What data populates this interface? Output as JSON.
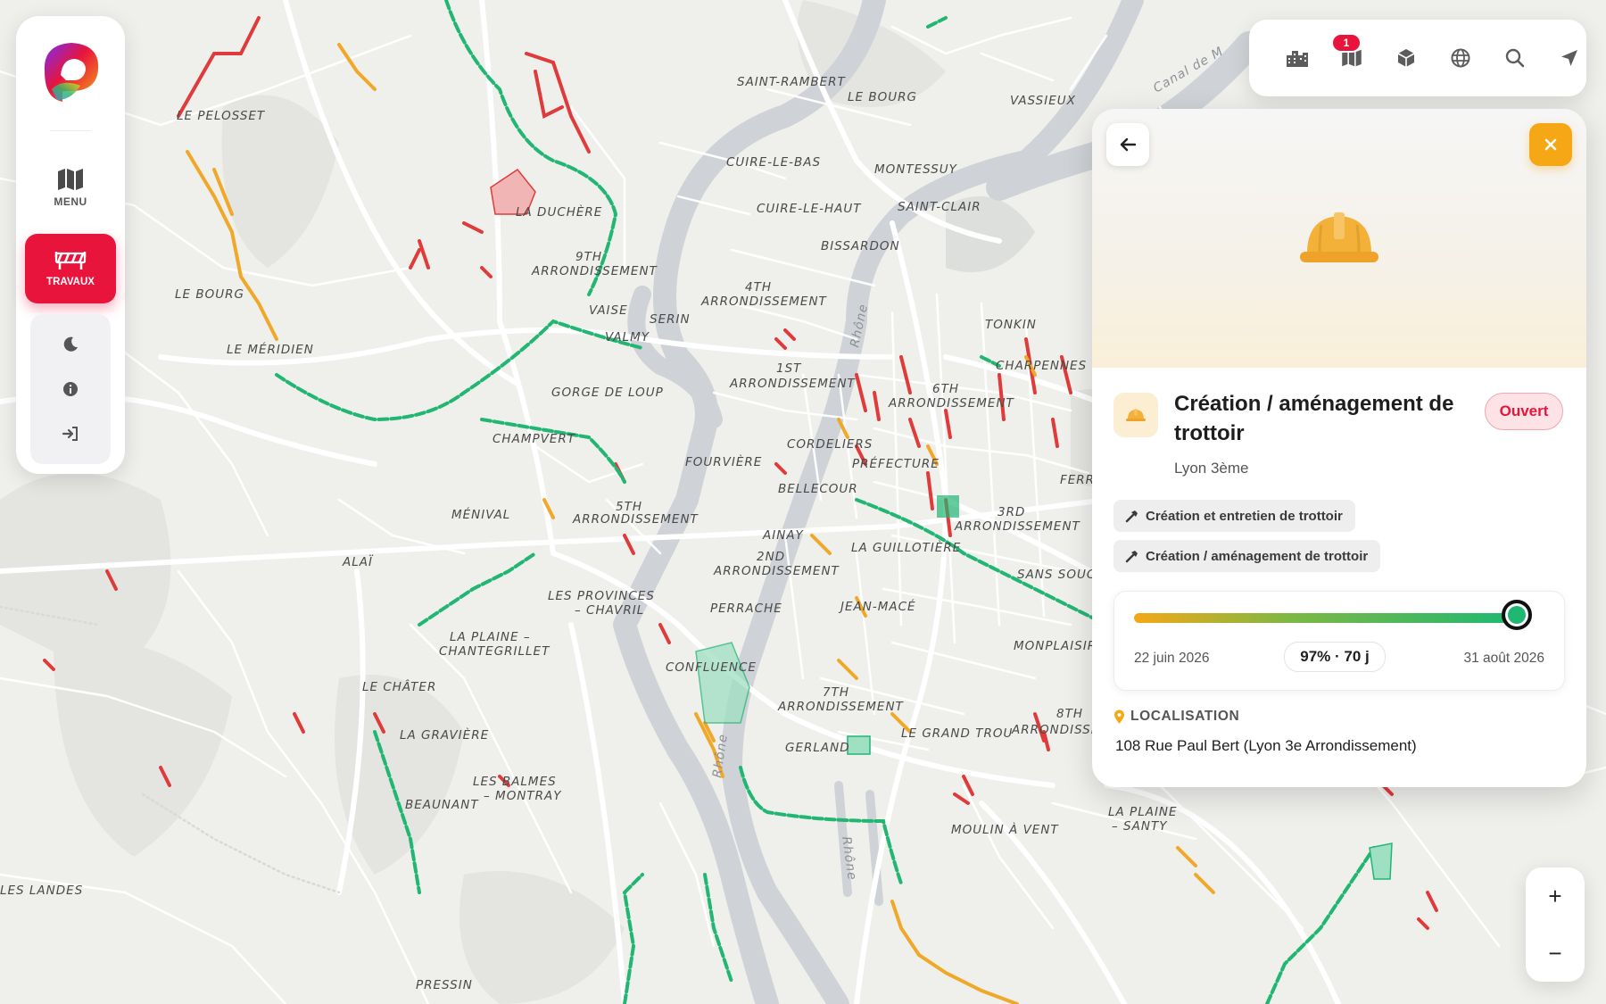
{
  "sidebar": {
    "menu_label": "MENU",
    "travaux_label": "TRAVAUX",
    "icons": [
      "map-icon",
      "roadworks-barrier-icon",
      "moon-icon",
      "info-icon",
      "login-icon"
    ]
  },
  "toolbar": {
    "buttons": [
      "buildings-icon",
      "map-layers-icon",
      "cube-3d-icon",
      "globe-icon",
      "search-icon",
      "locate-arrow-icon"
    ],
    "notification_count": "1"
  },
  "map": {
    "labels": [
      {
        "text": "SAINT-RAMBERT"
      },
      {
        "text": "LE BOURG"
      },
      {
        "text": "VASSIEUX"
      },
      {
        "text": "LE PELOSSET"
      },
      {
        "text": "CUIRE-LE-BAS"
      },
      {
        "text": "MONTESSUY"
      },
      {
        "text": "CUIRE-LE-HAUT"
      },
      {
        "text": "SAINT-CLAIR"
      },
      {
        "text": "LA DUCHÈRE"
      },
      {
        "text": "BISSARDON"
      },
      {
        "text": "9TH"
      },
      {
        "text": "ARRONDISSEMENT"
      },
      {
        "text": "LE BOURG"
      },
      {
        "text": "4TH"
      },
      {
        "text": "ARRONDISSEMENT"
      },
      {
        "text": "VAISE"
      },
      {
        "text": "SERIN"
      },
      {
        "text": "VALMY"
      },
      {
        "text": "TONKIN"
      },
      {
        "text": "LE MÉRIDIEN"
      },
      {
        "text": "CHARPENNES"
      },
      {
        "text": "1ST"
      },
      {
        "text": "ARRONDISSEMENT"
      },
      {
        "text": "6TH"
      },
      {
        "text": "ARRONDISSEMENT"
      },
      {
        "text": "GORGE DE LOUP"
      },
      {
        "text": "CHAMPVERT"
      },
      {
        "text": "CORDELIERS"
      },
      {
        "text": "FOURVIÈRE"
      },
      {
        "text": "PRÉFECTURE"
      },
      {
        "text": "FERR"
      },
      {
        "text": "BELLECOUR"
      },
      {
        "text": "MÉNIVAL"
      },
      {
        "text": "5TH"
      },
      {
        "text": "ARRONDISSEMENT"
      },
      {
        "text": "3RD"
      },
      {
        "text": "ARRONDISSEMENT"
      },
      {
        "text": "AINAY"
      },
      {
        "text": "LA GUILLOTIÈRE"
      },
      {
        "text": "ALAÏ"
      },
      {
        "text": "2ND"
      },
      {
        "text": "ARRONDISSEMENT"
      },
      {
        "text": "SANS SOUCI"
      },
      {
        "text": "LES PROVINCES"
      },
      {
        "text": "– CHAVRIL"
      },
      {
        "text": "PERRACHE"
      },
      {
        "text": "JEAN-MACÉ"
      },
      {
        "text": "LA PLAINE –"
      },
      {
        "text": "CHANTEGRILLET"
      },
      {
        "text": "MONPLAISIR"
      },
      {
        "text": "CONFLUENCE"
      },
      {
        "text": "LE CHÂTER"
      },
      {
        "text": "7TH"
      },
      {
        "text": "ARRONDISSEMENT"
      },
      {
        "text": "8TH"
      },
      {
        "text": "ARRONDISSE"
      },
      {
        "text": "LA GRAVIÈRE"
      },
      {
        "text": "LE GRAND TROU"
      },
      {
        "text": "GERLAND"
      },
      {
        "text": "LES BALMES"
      },
      {
        "text": "– MONTRAY"
      },
      {
        "text": "BEAUNANT"
      },
      {
        "text": "LA PLAINE"
      },
      {
        "text": "– SANTY"
      },
      {
        "text": "MOULIN À VENT"
      },
      {
        "text": "LES LANDES"
      },
      {
        "text": "PRESSIN"
      }
    ],
    "river_labels": [
      {
        "text": "Rhône"
      },
      {
        "text": "Rhône"
      },
      {
        "text": "Rhône"
      },
      {
        "text": "Canal de M"
      }
    ],
    "legend_colors": {
      "open": "#e03b3b",
      "planned": "#f0a82a",
      "in_progress": "#22b673"
    }
  },
  "panel": {
    "back_label": "←",
    "close_label": "✕",
    "title": "Création / aménagement de trottoir",
    "status": "Ouvert",
    "subtitle": "Lyon 3ème",
    "tags": [
      "Création et entretien de trottoir",
      "Création / aménagement de trottoir"
    ],
    "progress": {
      "start_date": "22 juin 2026",
      "end_date": "31 août 2026",
      "label": "97% · 70 j",
      "percent": 97
    },
    "location_heading": "LOCALISATION",
    "address": "108 Rue Paul Bert (Lyon 3e Arrondissement)",
    "accent_color": "#f5a716",
    "status_color": "#e8143c"
  },
  "zoom": {
    "in_label": "+",
    "out_label": "−"
  }
}
